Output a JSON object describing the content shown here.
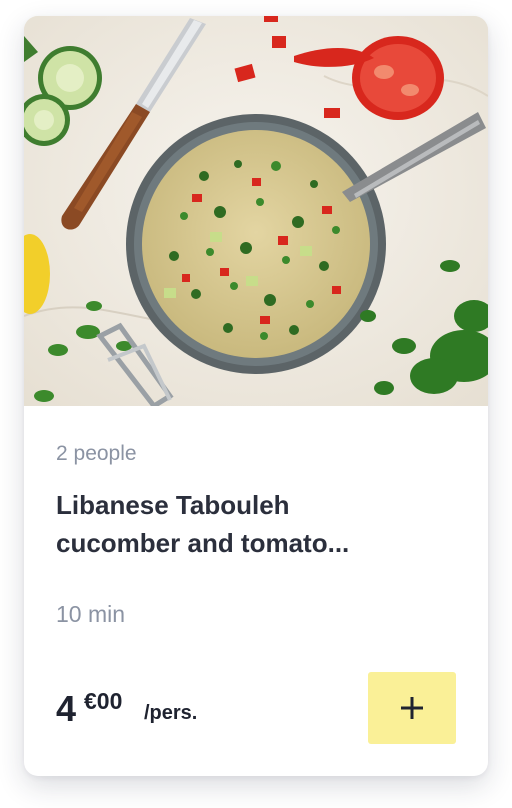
{
  "product": {
    "image_alt": "Libanese Tabouleh",
    "servings": "2 people",
    "title_line1": "Libanese Tabouleh",
    "title_line2": "cucomber and tomato...",
    "duration": "10 min",
    "price": {
      "integer": "4",
      "decimal": "€00",
      "unit": "/pers."
    },
    "add_button_icon": "plus-icon"
  },
  "colors": {
    "title_text": "#2b2f3c",
    "muted_text": "#8b93a3",
    "price_text": "#1f2330",
    "add_button_bg": "#faf097",
    "card_bg": "#ffffff"
  }
}
